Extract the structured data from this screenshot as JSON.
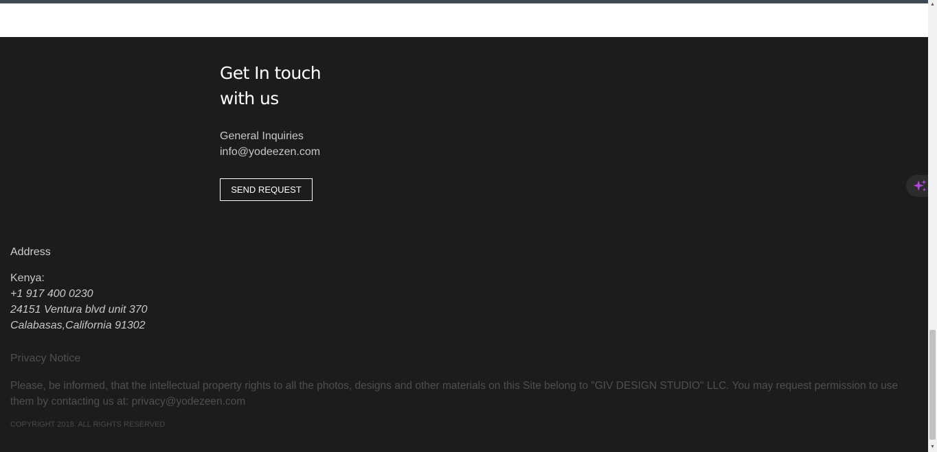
{
  "contact": {
    "heading_line1": "Get In touch",
    "heading_line2": "with us",
    "inquiries_label": "General Inquiries",
    "inquiries_email": "info@yodeezen.com",
    "send_button": "SEND REQUEST"
  },
  "address": {
    "title": "Address",
    "country": "Kenya:",
    "phone": "+1 917 400 0230",
    "street": "24151 Ventura blvd unit 370",
    "city": "Calabasas,California 91302"
  },
  "privacy": {
    "title": "Privacy Notice",
    "text": "Please, be informed, that the intellectual property rights to all the photos, designs and other materials on this Site belong to \"GIV DESIGN STUDIO\" LLC. You may request permission to use them by contacting us at: privacy@yodezeen.com"
  },
  "copyright": "COPYRIGHT 2018. ALL RIGHTS RESERVED",
  "icons": {
    "ai_widget": "sparkle-icon"
  },
  "colors": {
    "footer_bg": "#1c1c1c",
    "top_bar": "#3d4a55",
    "accent_sparkle": "#b046d8"
  }
}
